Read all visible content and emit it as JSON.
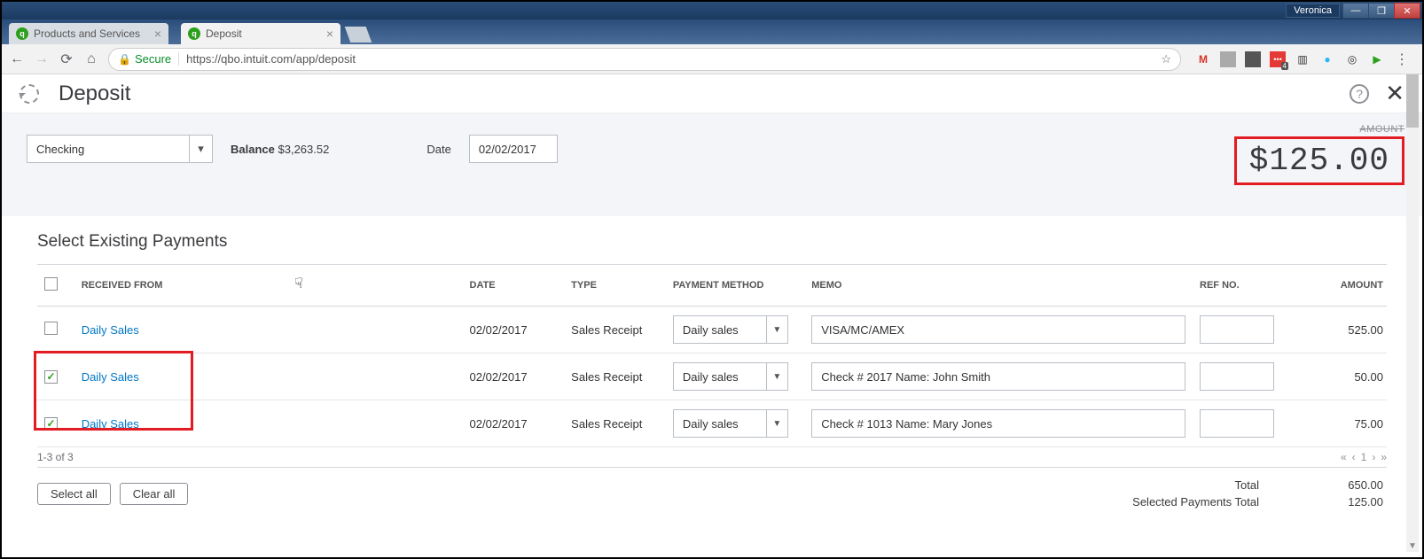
{
  "window": {
    "user": "Veronica"
  },
  "browser": {
    "tabs": [
      {
        "title": "Products and Services",
        "active": false
      },
      {
        "title": "Deposit",
        "active": true
      }
    ],
    "url_secure_label": "Secure",
    "url": "https://qbo.intuit.com/app/deposit"
  },
  "page": {
    "title": "Deposit",
    "account_selected": "Checking",
    "balance_label": "Balance",
    "balance_value": "$3,263.52",
    "date_label": "Date",
    "date_value": "02/02/2017",
    "amount_label": "AMOUNT",
    "amount_value": "$125.00"
  },
  "section": {
    "title": "Select Existing Payments",
    "columns": {
      "received_from": "RECEIVED FROM",
      "date": "DATE",
      "type": "TYPE",
      "payment_method": "PAYMENT METHOD",
      "memo": "MEMO",
      "ref_no": "REF NO.",
      "amount": "AMOUNT"
    },
    "rows": [
      {
        "checked": false,
        "received_from": "Daily Sales",
        "date": "02/02/2017",
        "type": "Sales Receipt",
        "payment_method": "Daily sales",
        "memo": "VISA/MC/AMEX",
        "ref_no": "",
        "amount": "525.00"
      },
      {
        "checked": true,
        "received_from": "Daily Sales",
        "date": "02/02/2017",
        "type": "Sales Receipt",
        "payment_method": "Daily sales",
        "memo": "Check # 2017 Name: John Smith",
        "ref_no": "",
        "amount": "50.00"
      },
      {
        "checked": true,
        "received_from": "Daily Sales",
        "date": "02/02/2017",
        "type": "Sales Receipt",
        "payment_method": "Daily sales",
        "memo": "Check # 1013 Name: Mary Jones",
        "ref_no": "",
        "amount": "75.00"
      }
    ],
    "range_text": "1-3 of 3",
    "pager_page": "1",
    "buttons": {
      "select_all": "Select all",
      "clear_all": "Clear all"
    },
    "totals": {
      "total_label": "Total",
      "total_value": "650.00",
      "selected_label": "Selected Payments Total",
      "selected_value": "125.00"
    }
  }
}
